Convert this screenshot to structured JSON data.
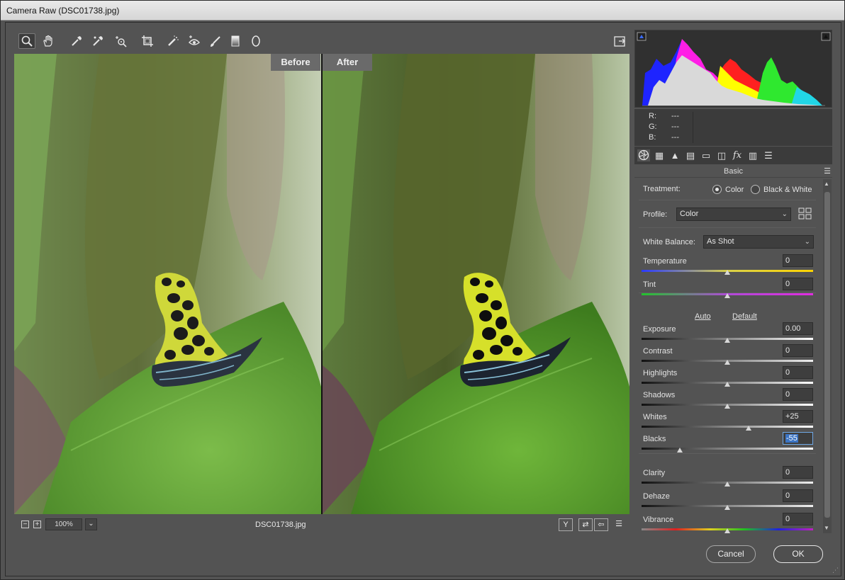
{
  "window": {
    "title": "Camera Raw (DSC01738.jpg)"
  },
  "toolbar": {
    "tools": [
      "zoom-tool-icon",
      "hand-tool-icon",
      "white-balance-tool-icon",
      "color-sampler-tool-icon",
      "targeted-adjustment-tool-icon",
      "crop-tool-icon",
      "spot-removal-tool-icon",
      "red-eye-removal-icon",
      "adjustment-brush-icon",
      "graduated-filter-icon",
      "radial-filter-icon"
    ],
    "toggle_fullscreen": "fullscreen-icon"
  },
  "preview": {
    "before_label": "Before",
    "after_label": "After"
  },
  "status": {
    "zoom": "100%",
    "filename": "DSC01738.jpg"
  },
  "rgb": {
    "r_label": "R:",
    "r_value": "---",
    "g_label": "G:",
    "g_value": "---",
    "b_label": "B:",
    "b_value": "---"
  },
  "panel": {
    "title": "Basic",
    "treatment_label": "Treatment:",
    "treatment_color": "Color",
    "treatment_bw": "Black & White",
    "profile_label": "Profile:",
    "profile_value": "Color",
    "wb_label": "White Balance:",
    "wb_value": "As Shot",
    "auto": "Auto",
    "default": "Default",
    "sliders": [
      {
        "name": "Temperature",
        "value": "0",
        "pos": 0.5
      },
      {
        "name": "Tint",
        "value": "0",
        "pos": 0.5
      },
      {
        "name": "Exposure",
        "value": "0.00",
        "pos": 0.5
      },
      {
        "name": "Contrast",
        "value": "0",
        "pos": 0.5
      },
      {
        "name": "Highlights",
        "value": "0",
        "pos": 0.5
      },
      {
        "name": "Shadows",
        "value": "0",
        "pos": 0.5
      },
      {
        "name": "Whites",
        "value": "+25",
        "pos": 0.625
      },
      {
        "name": "Blacks",
        "value": "-55",
        "pos": 0.225
      },
      {
        "name": "Clarity",
        "value": "0",
        "pos": 0.5
      },
      {
        "name": "Dehaze",
        "value": "0",
        "pos": 0.5
      },
      {
        "name": "Vibrance",
        "value": "0",
        "pos": 0.5
      }
    ]
  },
  "buttons": {
    "cancel": "Cancel",
    "ok": "OK"
  },
  "colors": {
    "accent": "#3b74c4",
    "panel": "#535353"
  }
}
